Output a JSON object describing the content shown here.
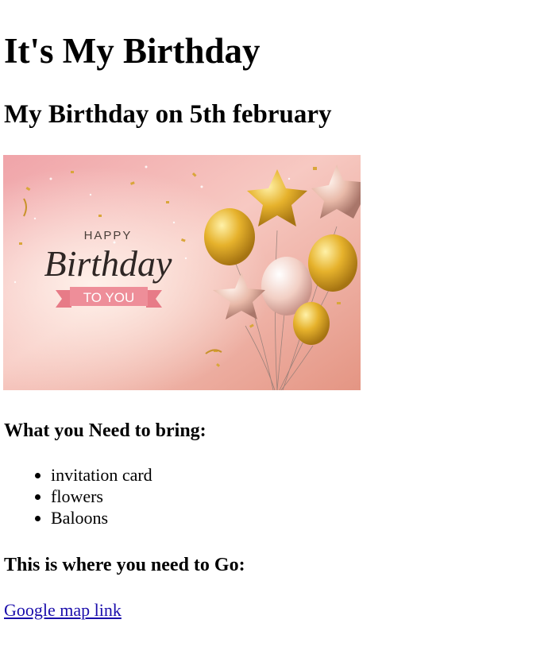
{
  "header": {
    "title": "It's My Birthday",
    "subtitle": "My Birthday on 5th february"
  },
  "banner": {
    "happy": "HAPPY",
    "birthday": "Birthday",
    "to_you": "TO YOU",
    "colors": {
      "bg_top": "#f0a6a8",
      "bg_bottom": "#e79b8c",
      "gold": "#e9b52e",
      "rose_gold": "#e3b3a3",
      "ribbon": "#ef8c97"
    }
  },
  "bring": {
    "title": "What you Need to bring:",
    "items": [
      "invitation card",
      "flowers",
      "Baloons"
    ]
  },
  "location": {
    "title": "This is where you need to Go:",
    "link_text": "Google map link"
  },
  "colors": {
    "link": "#1a0dab"
  }
}
